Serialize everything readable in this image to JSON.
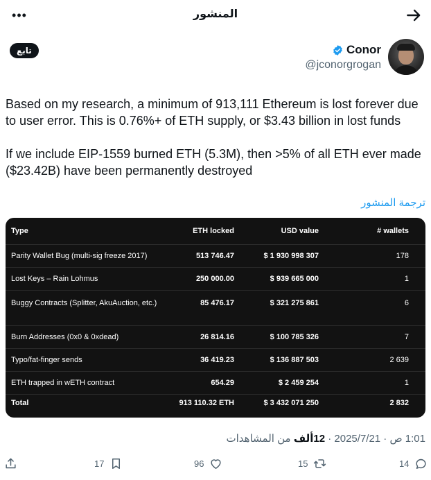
{
  "header": {
    "title": "المنشور",
    "more_icon": "more-dots-icon",
    "back_icon": "arrow-right-icon"
  },
  "follow_label": "تابع",
  "author": {
    "name": "Conor",
    "handle": "@jconorgrogan",
    "verified_color": "#1d9bf0"
  },
  "post": {
    "paragraph1": "Based on my research, a minimum of 913,111 Ethereum is lost forever due to user error.  This is 0.76%+ of ETH supply, or $3.43 billion in lost funds",
    "paragraph2": "If we include EIP-1559 burned ETH (5.3M), then >5% of all ETH ever made ($23.42B) have been permanently destroyed",
    "translate_label": "ترجمة المنشور"
  },
  "table": {
    "headers": [
      "Type",
      "ETH locked",
      "USD value",
      "# wallets"
    ],
    "rows": [
      {
        "type": "Parity Wallet Bug (multi-sig freeze 2017)",
        "eth": "513 746.47",
        "usd": "$ 1 930 998 307",
        "wallets": "178"
      },
      {
        "type": "Lost Keys – Rain Lohmus",
        "eth": "250 000.00",
        "usd": "$ 939 665 000",
        "wallets": "1"
      },
      {
        "type": "Buggy Contracts (Splitter, AkuAuction, etc.)",
        "eth": "85 476.17",
        "usd": "$ 321 275 861",
        "wallets": "6"
      },
      {
        "type": "Burn Addresses (0x0 & 0xdead)",
        "eth": "26 814.16",
        "usd": "$ 100 785 326",
        "wallets": "7"
      },
      {
        "type": "Typo/fat-finger sends",
        "eth": "36 419.23",
        "usd": "$ 136 887 503",
        "wallets": "2 639"
      },
      {
        "type": "ETH trapped in wETH contract",
        "eth": "654.29",
        "usd": "$ 2 459 254",
        "wallets": "1"
      }
    ],
    "total": {
      "type": "Total",
      "eth": "913 110.32 ETH",
      "usd": "$ 3 432 071 250",
      "wallets": "2 832"
    }
  },
  "meta": {
    "date": "2025/7/21",
    "time": "1:01 ص",
    "views_count": "12ألف",
    "views_label": "من المشاهدات"
  },
  "actions": {
    "replies": "14",
    "reposts": "15",
    "likes": "96",
    "bookmarks": "17"
  }
}
